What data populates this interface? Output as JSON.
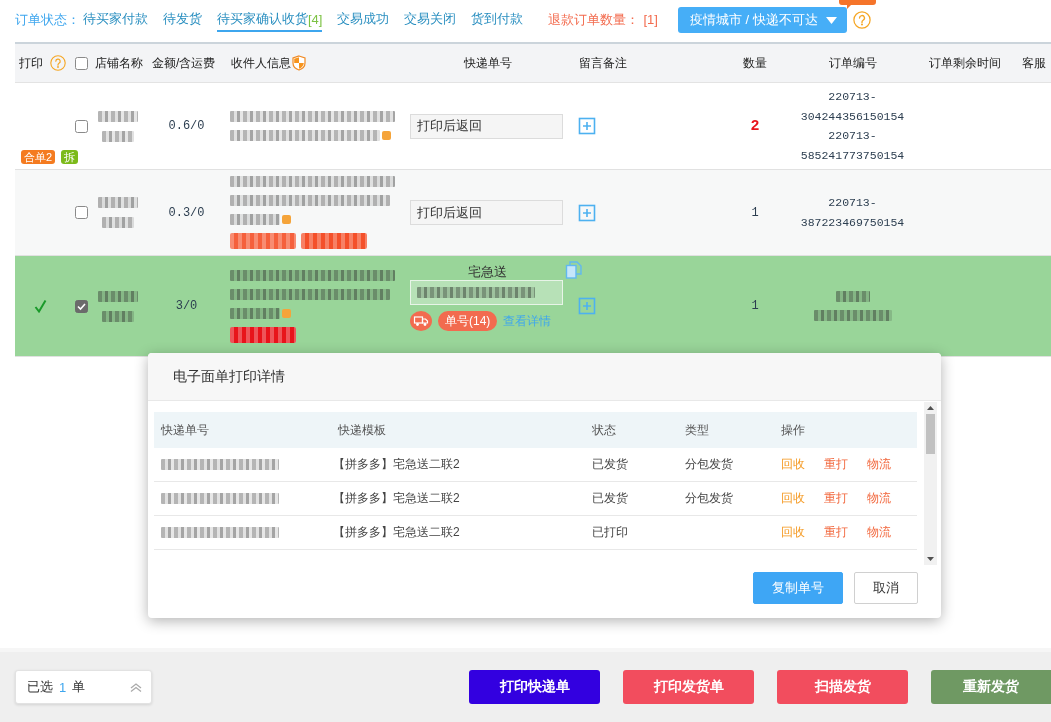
{
  "status_bar": {
    "label": "订单状态：",
    "tabs": [
      {
        "label": "待买家付款",
        "selected": false
      },
      {
        "label": "待发货",
        "selected": false
      },
      {
        "label": "待买家确认收货",
        "count": "[4]",
        "selected": true
      },
      {
        "label": "交易成功",
        "selected": false
      },
      {
        "label": "交易关闭",
        "selected": false
      },
      {
        "label": "货到付款",
        "selected": false
      }
    ],
    "refund": {
      "label": "退款订单数量：",
      "count": "[1]"
    },
    "filter_button": {
      "label": "疫情城市 / 快递不可达"
    }
  },
  "table": {
    "columns": [
      "打印",
      "店铺名称",
      "金额/含运费",
      "收件人信息",
      "快递单号",
      "留言备注",
      "数量",
      "订单编号",
      "订单剩余时间",
      "客服"
    ],
    "select_all": {
      "checked": false
    },
    "rows": [
      {
        "selected": false,
        "printed": false,
        "checked": false,
        "amount": "0.6/0",
        "tags": [
          {
            "label": "合单2",
            "color": "#f47b20"
          },
          {
            "label": "拆",
            "color": "#7cba1a"
          }
        ],
        "tracking": {
          "value": "打印后返回"
        },
        "quantity": "2",
        "quantity_alert": true,
        "order_numbers": [
          "220713-304244356150154",
          "220713-585241773750154"
        ]
      },
      {
        "selected": false,
        "printed": false,
        "checked": false,
        "amount": "0.3/0",
        "flags": [
          {
            "color": "#f5603c"
          },
          {
            "color": "#f4502a"
          }
        ],
        "tracking": {
          "value": "打印后返回"
        },
        "quantity": "1",
        "quantity_alert": false,
        "order_numbers": [
          "220713-387223469750154"
        ]
      },
      {
        "selected": true,
        "printed": true,
        "checked": true,
        "amount": "3/0",
        "flags": [
          {
            "color": "#e8141b"
          }
        ],
        "tracking": {
          "carrier": "宅急送"
        },
        "shipment": {
          "badge": "单号(14)",
          "link": "查看详情"
        },
        "quantity": "1",
        "quantity_alert": false
      }
    ]
  },
  "modal": {
    "title": "电子面单打印详情",
    "columns": [
      "快递单号",
      "快递模板",
      "状态",
      "类型",
      "操作"
    ],
    "rows": [
      {
        "template": "【拼多多】宅急送二联2",
        "status": "已发货",
        "type": "分包发货",
        "actions": [
          {
            "label": "回收",
            "kind": "warning"
          },
          {
            "label": "重打",
            "kind": "danger"
          },
          {
            "label": "物流",
            "kind": "danger"
          }
        ]
      },
      {
        "template": "【拼多多】宅急送二联2",
        "status": "已发货",
        "type": "分包发货",
        "actions": [
          {
            "label": "回收",
            "kind": "warning"
          },
          {
            "label": "重打",
            "kind": "danger"
          },
          {
            "label": "物流",
            "kind": "danger"
          }
        ]
      },
      {
        "template": "【拼多多】宅急送二联2",
        "status": "已打印",
        "actions": [
          {
            "label": "回收",
            "kind": "warning"
          },
          {
            "label": "重打",
            "kind": "danger"
          },
          {
            "label": "物流",
            "kind": "danger"
          }
        ]
      }
    ],
    "buttons": [
      {
        "label": "复制单号",
        "kind": "primary"
      },
      {
        "label": "取消",
        "kind": "default"
      }
    ]
  },
  "footer": {
    "selection": {
      "label": "已选",
      "count": "1",
      "unit": "单"
    },
    "buttons": [
      {
        "label": "打印快递单",
        "color": "#3300e0"
      },
      {
        "label": "打印发货单",
        "color": "#f24d5e"
      },
      {
        "label": "扫描发货",
        "color": "#f24d5e"
      },
      {
        "label": "重新发货",
        "color": "#6f9963"
      }
    ]
  }
}
